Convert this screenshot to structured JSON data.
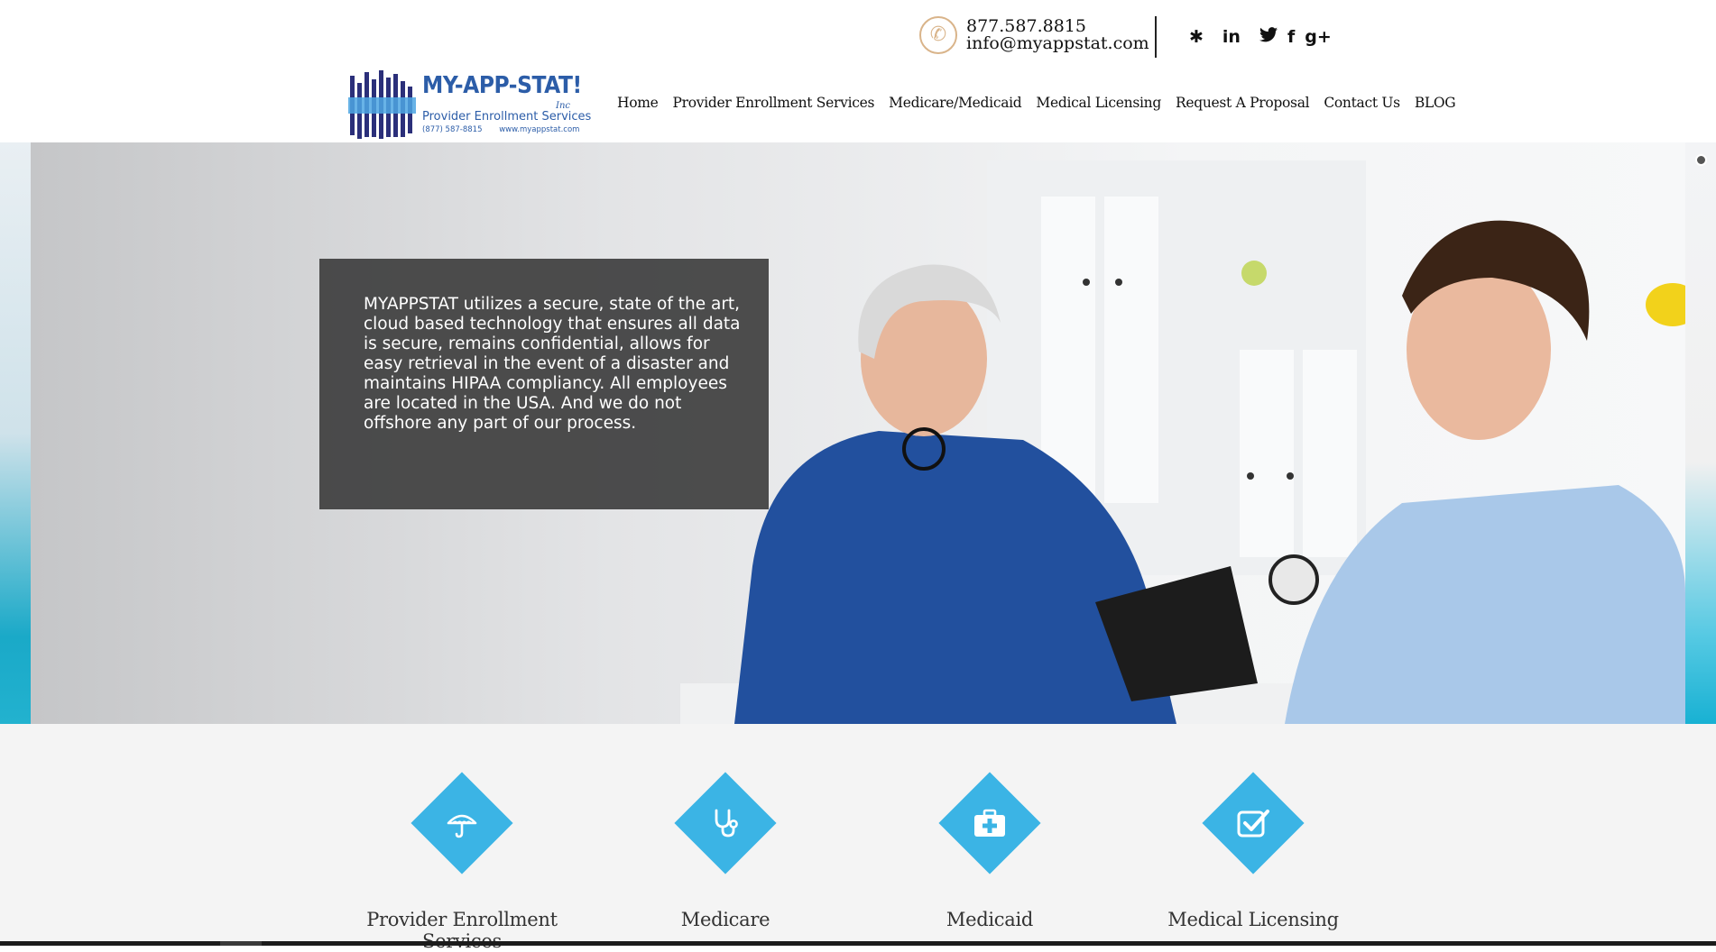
{
  "header": {
    "phone": "877.587.8815",
    "email": "info@myappstat.com",
    "social": [
      "yelp-icon",
      "linkedin-icon",
      "twitter-icon",
      "facebook-icon",
      "google-plus-icon"
    ],
    "social_glyphs": {
      "yelp": "✱",
      "linkedin": "in",
      "twitter": "🐦",
      "facebook": "f",
      "google_plus": "g+"
    }
  },
  "logo": {
    "title": "MY-APP-STAT!",
    "inc": "Inc",
    "subtitle": "Provider Enrollment Services",
    "phone": "(877) 587-8815",
    "website": "www.myappstat.com"
  },
  "nav": {
    "items": [
      "Home",
      "Provider Enrollment Services",
      "Medicare/Medicaid",
      "Medical Licensing",
      "Request A Proposal",
      "Contact Us",
      "BLOG"
    ]
  },
  "hero": {
    "text": "MYAPPSTAT utilizes a secure, state of the art, cloud based technology that ensures all data is secure, remains confidential, allows for easy retrieval in the event of a disaster and maintains HIPAA compliancy. All employees are located in the USA. And we do not offshore any part of our process."
  },
  "features": [
    {
      "label": "Provider Enrollment Services",
      "icon": "umbrella-icon"
    },
    {
      "label": "Medicare",
      "icon": "stethoscope-icon"
    },
    {
      "label": "Medicaid",
      "icon": "first-aid-kit-icon"
    },
    {
      "label": "Medical Licensing",
      "icon": "checkbox-icon"
    }
  ],
  "colors": {
    "accent": "#3bb4e5",
    "logo_blue": "#2c5da8",
    "phone_icon": "#d9b48a",
    "overlay": "#404040"
  }
}
